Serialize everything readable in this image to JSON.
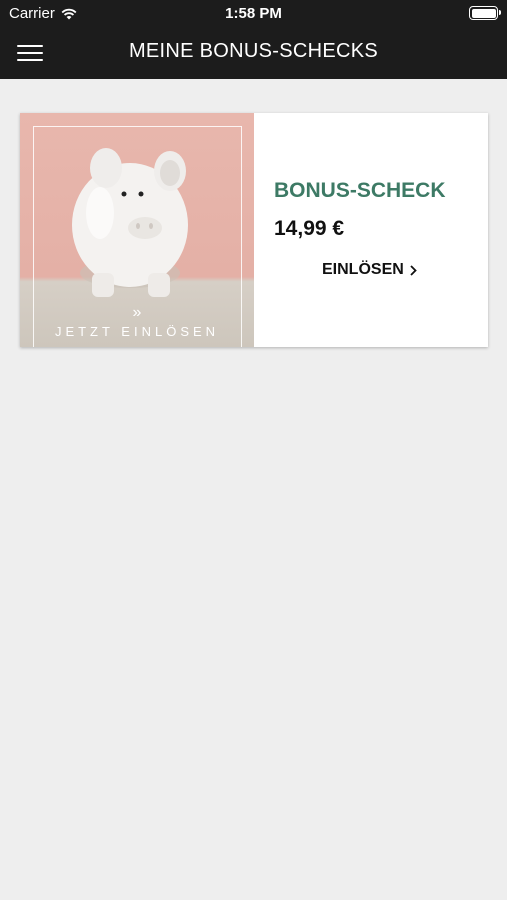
{
  "status_bar": {
    "carrier": "Carrier",
    "time": "1:58 PM",
    "battery_level": 1.0
  },
  "nav": {
    "title": "MEINE BONUS-SCHECKS",
    "menu_icon": "hamburger-icon"
  },
  "vouchers": [
    {
      "image_caption": "JETZT EINLÖSEN",
      "label": "BONUS-SCHECK",
      "amount": "14,99 €",
      "redeem_label": "EINLÖSEN",
      "redeem_icon": "chevron-right-icon"
    }
  ],
  "colors": {
    "bar_background": "#1c1c1c",
    "page_background": "#eeeeee",
    "accent_green": "#3d7a65",
    "image_pink": "#e8b7ad"
  }
}
